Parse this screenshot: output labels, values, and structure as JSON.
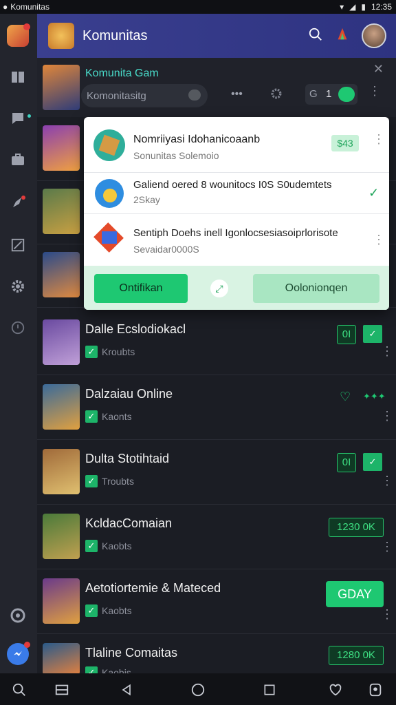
{
  "status_bar": {
    "app_label": "Komunitas",
    "time": "12:35"
  },
  "header": {
    "title": "Komunitas"
  },
  "pinned": {
    "title": "Komunita Gam",
    "search_placeholder": "Komonitasitg",
    "badge_count": "1"
  },
  "popup": {
    "items": [
      {
        "title": "Nomriiyasi Idohanicoaanb",
        "subtitle": "Sonunitas Solemoio",
        "tag": "$43"
      },
      {
        "title": "Galiend oered 8 wounitocs I0S S0udemtets",
        "subtitle": "2Skay"
      },
      {
        "title": "Sentiph Doehs inell Igonlocsesiasoiprlorisote",
        "subtitle": "Sevaidar0000S"
      }
    ],
    "left_button": "Ontifikan",
    "right_button": "Oolonionqen"
  },
  "rows": [
    {
      "name": "Dalle Ecslodiokacl",
      "sub": "Kroubts",
      "tag": "0I"
    },
    {
      "name": "Dalzaiau Online",
      "sub": "Kaonts",
      "tag": ""
    },
    {
      "name": "Dulta Stotihtaid",
      "sub": "Troubts",
      "tag": "0I"
    },
    {
      "name": "KcldacComaian",
      "sub": "Kaobts",
      "tag": "1230 0K"
    },
    {
      "name": "Aetotiortemie & Mateced",
      "sub": "Kaobts",
      "tag": "GDAY"
    },
    {
      "name": "Tlaline Comaitas",
      "sub": "Kaobis",
      "tag": "1280 0K"
    }
  ],
  "icons": {
    "rail": [
      "app-logo-icon",
      "book-icon",
      "chat-icon",
      "briefcase-icon",
      "rocket-icon",
      "edit-square-icon",
      "gear-icon",
      "shield-icon",
      "circle-icon",
      "messenger-icon"
    ],
    "header": [
      "search-icon",
      "flame-icon",
      "avatar"
    ],
    "bottom": [
      "search-icon",
      "inbox-icon",
      "back-icon",
      "home-icon",
      "recents-icon",
      "heart-icon",
      "profile-icon"
    ]
  },
  "colors": {
    "accent_green": "#1ec872",
    "header_bg": "#363b8a",
    "background": "#1b1d24"
  }
}
